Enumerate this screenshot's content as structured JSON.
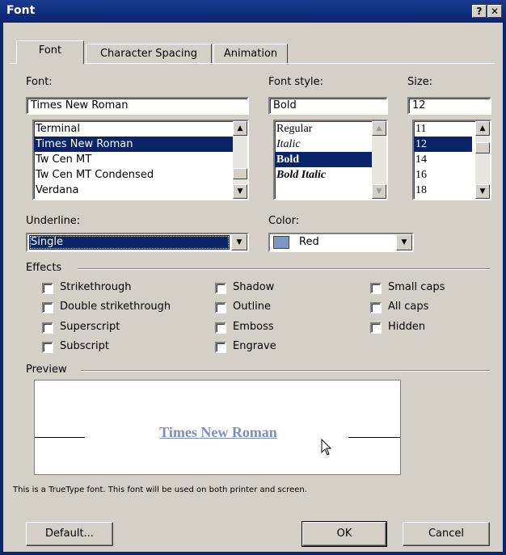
{
  "window": {
    "title": "Font",
    "help_glyph": "?",
    "close_glyph": "✕"
  },
  "tabs": [
    {
      "label": "Font",
      "active": true
    },
    {
      "label": "Character Spacing",
      "active": false
    },
    {
      "label": "Animation",
      "active": false
    }
  ],
  "font": {
    "label": "Font:",
    "value": "Times New Roman",
    "items": [
      "Terminal",
      "Times New Roman",
      "Tw Cen MT",
      "Tw Cen MT Condensed",
      "Verdana"
    ],
    "selected_index": 1
  },
  "font_style": {
    "label": "Font style:",
    "value": "Bold",
    "items": [
      "Regular",
      "Italic",
      "Bold",
      "Bold Italic"
    ],
    "selected_index": 2
  },
  "size": {
    "label": "Size:",
    "value": "12",
    "items": [
      "11",
      "12",
      "14",
      "16",
      "18"
    ],
    "selected_index": 1
  },
  "underline": {
    "label": "Underline:",
    "value": "Single"
  },
  "color": {
    "label": "Color:",
    "value": "Red",
    "swatch": "#7f95c2"
  },
  "effects": {
    "label": "Effects",
    "items": [
      "Strikethrough",
      "Double strikethrough",
      "Superscript",
      "Subscript",
      "Shadow",
      "Outline",
      "Emboss",
      "Engrave",
      "Small caps",
      "All caps",
      "Hidden"
    ]
  },
  "preview": {
    "label": "Preview",
    "sample": "Times New Roman"
  },
  "note": "This is a TrueType font. This font will be used on both printer and screen.",
  "buttons": {
    "default": "Default...",
    "ok": "OK",
    "cancel": "Cancel"
  },
  "colors": {
    "titlebar": "#0a2470",
    "face": "#d4d0c8",
    "selection": "#0a246a"
  }
}
